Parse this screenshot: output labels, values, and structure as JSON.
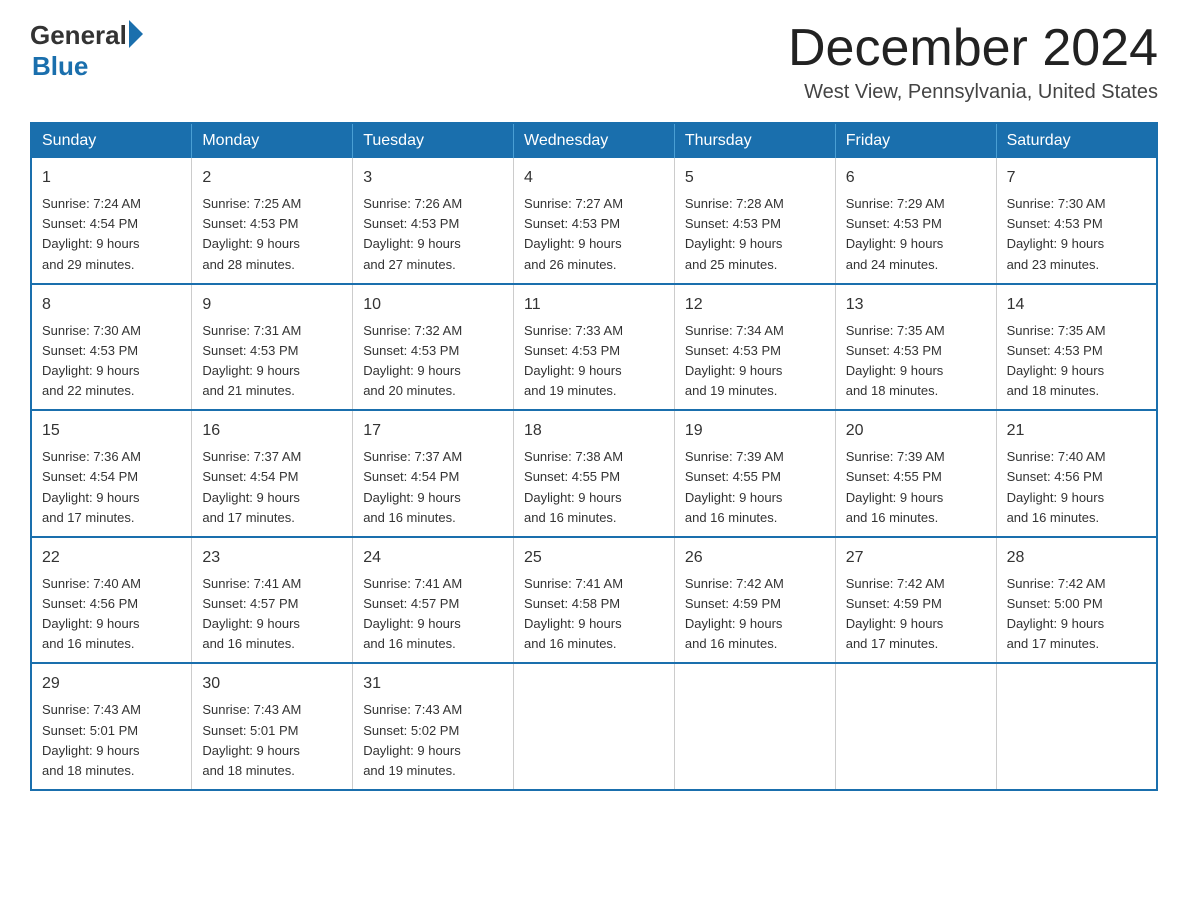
{
  "logo": {
    "text_general": "General",
    "text_blue": "Blue"
  },
  "header": {
    "month": "December 2024",
    "location": "West View, Pennsylvania, United States"
  },
  "weekdays": [
    "Sunday",
    "Monday",
    "Tuesday",
    "Wednesday",
    "Thursday",
    "Friday",
    "Saturday"
  ],
  "weeks": [
    [
      {
        "day": "1",
        "sunrise": "7:24 AM",
        "sunset": "4:54 PM",
        "daylight": "9 hours and 29 minutes."
      },
      {
        "day": "2",
        "sunrise": "7:25 AM",
        "sunset": "4:53 PM",
        "daylight": "9 hours and 28 minutes."
      },
      {
        "day": "3",
        "sunrise": "7:26 AM",
        "sunset": "4:53 PM",
        "daylight": "9 hours and 27 minutes."
      },
      {
        "day": "4",
        "sunrise": "7:27 AM",
        "sunset": "4:53 PM",
        "daylight": "9 hours and 26 minutes."
      },
      {
        "day": "5",
        "sunrise": "7:28 AM",
        "sunset": "4:53 PM",
        "daylight": "9 hours and 25 minutes."
      },
      {
        "day": "6",
        "sunrise": "7:29 AM",
        "sunset": "4:53 PM",
        "daylight": "9 hours and 24 minutes."
      },
      {
        "day": "7",
        "sunrise": "7:30 AM",
        "sunset": "4:53 PM",
        "daylight": "9 hours and 23 minutes."
      }
    ],
    [
      {
        "day": "8",
        "sunrise": "7:30 AM",
        "sunset": "4:53 PM",
        "daylight": "9 hours and 22 minutes."
      },
      {
        "day": "9",
        "sunrise": "7:31 AM",
        "sunset": "4:53 PM",
        "daylight": "9 hours and 21 minutes."
      },
      {
        "day": "10",
        "sunrise": "7:32 AM",
        "sunset": "4:53 PM",
        "daylight": "9 hours and 20 minutes."
      },
      {
        "day": "11",
        "sunrise": "7:33 AM",
        "sunset": "4:53 PM",
        "daylight": "9 hours and 19 minutes."
      },
      {
        "day": "12",
        "sunrise": "7:34 AM",
        "sunset": "4:53 PM",
        "daylight": "9 hours and 19 minutes."
      },
      {
        "day": "13",
        "sunrise": "7:35 AM",
        "sunset": "4:53 PM",
        "daylight": "9 hours and 18 minutes."
      },
      {
        "day": "14",
        "sunrise": "7:35 AM",
        "sunset": "4:53 PM",
        "daylight": "9 hours and 18 minutes."
      }
    ],
    [
      {
        "day": "15",
        "sunrise": "7:36 AM",
        "sunset": "4:54 PM",
        "daylight": "9 hours and 17 minutes."
      },
      {
        "day": "16",
        "sunrise": "7:37 AM",
        "sunset": "4:54 PM",
        "daylight": "9 hours and 17 minutes."
      },
      {
        "day": "17",
        "sunrise": "7:37 AM",
        "sunset": "4:54 PM",
        "daylight": "9 hours and 16 minutes."
      },
      {
        "day": "18",
        "sunrise": "7:38 AM",
        "sunset": "4:55 PM",
        "daylight": "9 hours and 16 minutes."
      },
      {
        "day": "19",
        "sunrise": "7:39 AM",
        "sunset": "4:55 PM",
        "daylight": "9 hours and 16 minutes."
      },
      {
        "day": "20",
        "sunrise": "7:39 AM",
        "sunset": "4:55 PM",
        "daylight": "9 hours and 16 minutes."
      },
      {
        "day": "21",
        "sunrise": "7:40 AM",
        "sunset": "4:56 PM",
        "daylight": "9 hours and 16 minutes."
      }
    ],
    [
      {
        "day": "22",
        "sunrise": "7:40 AM",
        "sunset": "4:56 PM",
        "daylight": "9 hours and 16 minutes."
      },
      {
        "day": "23",
        "sunrise": "7:41 AM",
        "sunset": "4:57 PM",
        "daylight": "9 hours and 16 minutes."
      },
      {
        "day": "24",
        "sunrise": "7:41 AM",
        "sunset": "4:57 PM",
        "daylight": "9 hours and 16 minutes."
      },
      {
        "day": "25",
        "sunrise": "7:41 AM",
        "sunset": "4:58 PM",
        "daylight": "9 hours and 16 minutes."
      },
      {
        "day": "26",
        "sunrise": "7:42 AM",
        "sunset": "4:59 PM",
        "daylight": "9 hours and 16 minutes."
      },
      {
        "day": "27",
        "sunrise": "7:42 AM",
        "sunset": "4:59 PM",
        "daylight": "9 hours and 17 minutes."
      },
      {
        "day": "28",
        "sunrise": "7:42 AM",
        "sunset": "5:00 PM",
        "daylight": "9 hours and 17 minutes."
      }
    ],
    [
      {
        "day": "29",
        "sunrise": "7:43 AM",
        "sunset": "5:01 PM",
        "daylight": "9 hours and 18 minutes."
      },
      {
        "day": "30",
        "sunrise": "7:43 AM",
        "sunset": "5:01 PM",
        "daylight": "9 hours and 18 minutes."
      },
      {
        "day": "31",
        "sunrise": "7:43 AM",
        "sunset": "5:02 PM",
        "daylight": "9 hours and 19 minutes."
      },
      null,
      null,
      null,
      null
    ]
  ],
  "labels": {
    "sunrise": "Sunrise:",
    "sunset": "Sunset:",
    "daylight": "Daylight:"
  }
}
